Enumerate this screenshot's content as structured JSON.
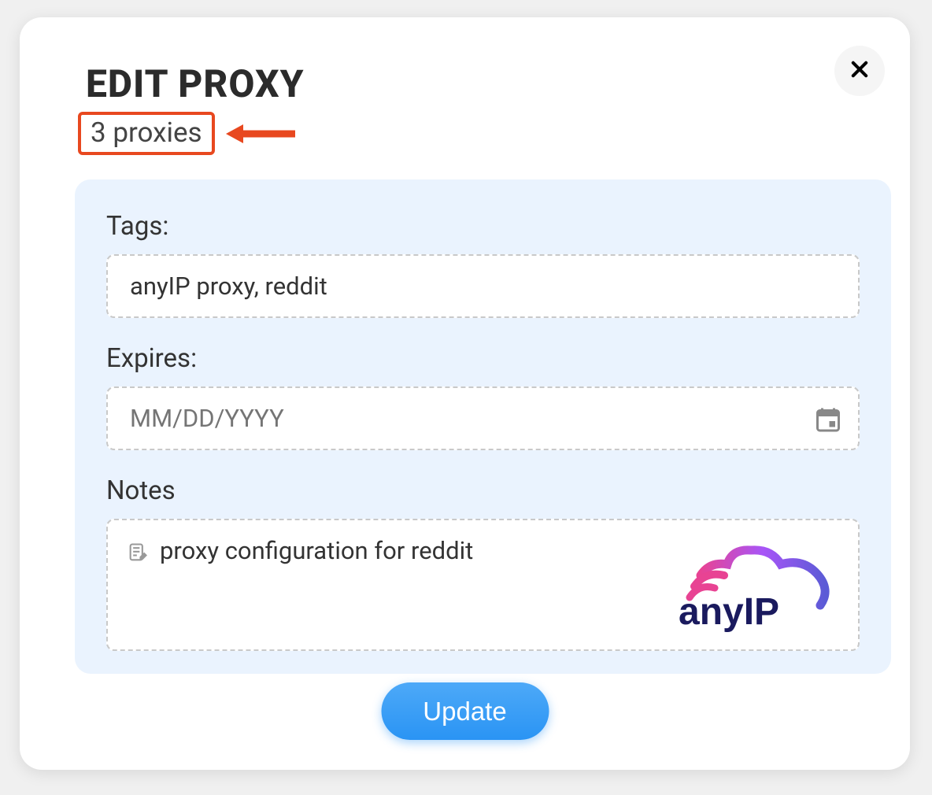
{
  "modal": {
    "title": "EDIT PROXY",
    "subtitle": "3 proxies",
    "close_icon": "close-icon"
  },
  "form": {
    "tags": {
      "label": "Tags:",
      "value": "anyIP proxy, reddit"
    },
    "expires": {
      "label": "Expires:",
      "placeholder": "MM/DD/YYYY",
      "value": ""
    },
    "notes": {
      "label": "Notes",
      "value": "proxy configuration for reddit"
    }
  },
  "logo": {
    "text": "anyIP"
  },
  "actions": {
    "update_label": "Update"
  },
  "annotation": {
    "highlight_color": "#e8481f"
  }
}
